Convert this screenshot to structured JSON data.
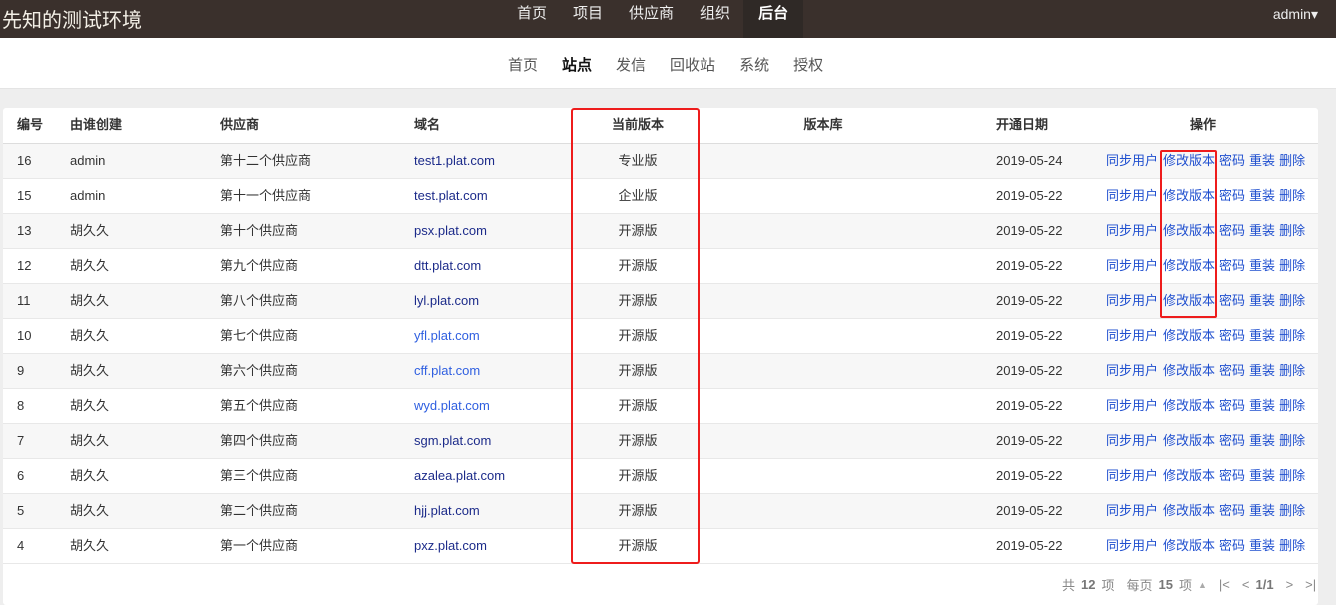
{
  "brand": "先知的测试环境",
  "topnav": [
    "首页",
    "项目",
    "供应商",
    "组织",
    "后台"
  ],
  "topnav_active": 4,
  "user": "admin",
  "subnav": [
    "首页",
    "站点",
    "发信",
    "回收站",
    "系统",
    "授权"
  ],
  "subnav_active": 1,
  "table": {
    "headers": [
      "编号",
      "由谁创建",
      "供应商",
      "域名",
      "当前版本",
      "版本库",
      "开通日期",
      "操作"
    ],
    "actions": [
      "同步用户",
      "修改版本",
      "密码",
      "重装",
      "删除"
    ],
    "rows": [
      {
        "id": "16",
        "creator": "admin",
        "vendor": "第十二个供应商",
        "domain": "test1.plat.com",
        "version": "专业版",
        "repo": "",
        "date": "2019-05-24",
        "visited": true
      },
      {
        "id": "15",
        "creator": "admin",
        "vendor": "第十一个供应商",
        "domain": "test.plat.com",
        "version": "企业版",
        "repo": "",
        "date": "2019-05-22",
        "visited": true
      },
      {
        "id": "13",
        "creator": "胡久久",
        "vendor": "第十个供应商",
        "domain": "psx.plat.com",
        "version": "开源版",
        "repo": "",
        "date": "2019-05-22",
        "visited": true
      },
      {
        "id": "12",
        "creator": "胡久久",
        "vendor": "第九个供应商",
        "domain": "dtt.plat.com",
        "version": "开源版",
        "repo": "",
        "date": "2019-05-22",
        "visited": true
      },
      {
        "id": "11",
        "creator": "胡久久",
        "vendor": "第八个供应商",
        "domain": "lyl.plat.com",
        "version": "开源版",
        "repo": "",
        "date": "2019-05-22",
        "visited": true
      },
      {
        "id": "10",
        "creator": "胡久久",
        "vendor": "第七个供应商",
        "domain": "yfl.plat.com",
        "version": "开源版",
        "repo": "",
        "date": "2019-05-22",
        "visited": false
      },
      {
        "id": "9",
        "creator": "胡久久",
        "vendor": "第六个供应商",
        "domain": "cff.plat.com",
        "version": "开源版",
        "repo": "",
        "date": "2019-05-22",
        "visited": false
      },
      {
        "id": "8",
        "creator": "胡久久",
        "vendor": "第五个供应商",
        "domain": "wyd.plat.com",
        "version": "开源版",
        "repo": "",
        "date": "2019-05-22",
        "visited": false
      },
      {
        "id": "7",
        "creator": "胡久久",
        "vendor": "第四个供应商",
        "domain": "sgm.plat.com",
        "version": "开源版",
        "repo": "",
        "date": "2019-05-22",
        "visited": true
      },
      {
        "id": "6",
        "creator": "胡久久",
        "vendor": "第三个供应商",
        "domain": "azalea.plat.com",
        "version": "开源版",
        "repo": "",
        "date": "2019-05-22",
        "visited": true
      },
      {
        "id": "5",
        "creator": "胡久久",
        "vendor": "第二个供应商",
        "domain": "hjj.plat.com",
        "version": "开源版",
        "repo": "",
        "date": "2019-05-22",
        "visited": true
      },
      {
        "id": "4",
        "creator": "胡久久",
        "vendor": "第一个供应商",
        "domain": "pxz.plat.com",
        "version": "开源版",
        "repo": "",
        "date": "2019-05-22",
        "visited": true
      }
    ]
  },
  "pager": {
    "total_prefix": "共",
    "total": "12",
    "total_suffix": "项",
    "per_prefix": "每页",
    "per": "15",
    "per_suffix": "项",
    "page": "1/1"
  },
  "colors": {
    "highlight": "#ee1c1c",
    "topbar": "#3a302c"
  }
}
